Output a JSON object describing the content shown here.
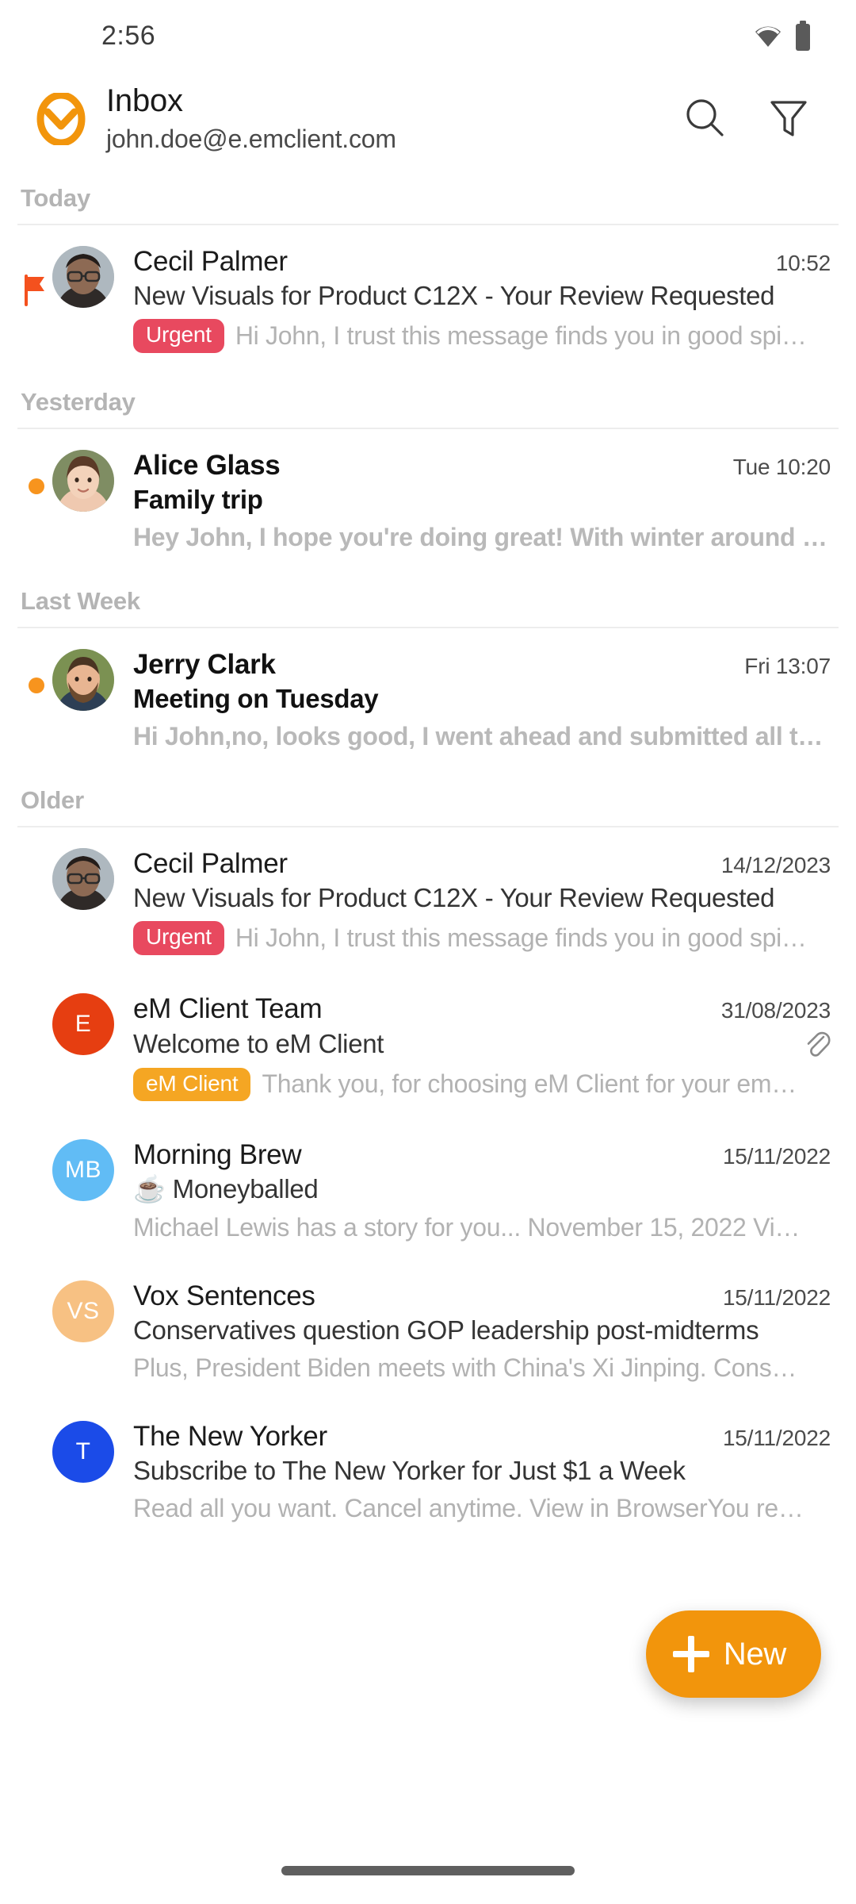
{
  "status_bar": {
    "time": "2:56",
    "wifi_icon": "wifi-icon",
    "battery_icon": "battery-icon"
  },
  "header": {
    "logo_icon": "em-client-logo-icon",
    "title": "Inbox",
    "account": "john.doe@e.emclient.com",
    "search_icon": "search-icon",
    "filter_icon": "filter-funnel-icon",
    "accent_color": "#F2950C"
  },
  "sections": [
    {
      "label": "Today",
      "messages": [
        {
          "sender": "Cecil Palmer",
          "time": "10:52",
          "subject": "New Visuals for Product C12X - Your Review Requested",
          "preview": "Hi John, I trust this message finds you in good spi…",
          "tag": "Urgent",
          "tag_color": "#E8495F",
          "unread": false,
          "flagged": true,
          "attachment": false,
          "avatar_type": "photo-man-glasses",
          "avatar_initials": "",
          "avatar_color": "#9aa6ae"
        }
      ]
    },
    {
      "label": "Yesterday",
      "messages": [
        {
          "sender": "Alice Glass",
          "time": "Tue 10:20",
          "subject": "Family trip",
          "preview": "Hey John, I hope you're doing great! With winter around t…",
          "tag": "",
          "tag_color": "",
          "unread": true,
          "flagged": false,
          "attachment": false,
          "avatar_type": "photo-woman",
          "avatar_initials": "",
          "avatar_color": "#c8a98e"
        }
      ]
    },
    {
      "label": "Last Week",
      "messages": [
        {
          "sender": "Jerry Clark",
          "time": "Fri 13:07",
          "subject": "Meeting on Tuesday",
          "preview": "Hi John,no, looks good, I went ahead and submitted all th…",
          "tag": "",
          "tag_color": "",
          "unread": true,
          "flagged": false,
          "attachment": false,
          "avatar_type": "photo-man-beard",
          "avatar_initials": "",
          "avatar_color": "#7e8f5e"
        }
      ]
    },
    {
      "label": "Older",
      "messages": [
        {
          "sender": "Cecil Palmer",
          "time": "14/12/2023",
          "subject": "New Visuals for Product C12X - Your Review Requested",
          "preview": "Hi John, I trust this message finds you in good spi…",
          "tag": "Urgent",
          "tag_color": "#E8495F",
          "unread": false,
          "flagged": false,
          "attachment": false,
          "avatar_type": "photo-man-glasses",
          "avatar_initials": "",
          "avatar_color": "#9aa6ae"
        },
        {
          "sender": "eM Client Team",
          "time": "31/08/2023",
          "subject": "Welcome to eM Client",
          "preview": "Thank you, for choosing eM Client for your em…",
          "tag": "eM Client",
          "tag_color": "#F5A623",
          "unread": false,
          "flagged": false,
          "attachment": true,
          "avatar_type": "initials",
          "avatar_initials": "E",
          "avatar_color": "#E63E11"
        },
        {
          "sender": "Morning Brew",
          "time": "15/11/2022",
          "subject": "☕ Moneyballed",
          "preview": "Michael Lewis has a story for you... November 15, 2022 Vi…",
          "tag": "",
          "tag_color": "",
          "unread": false,
          "flagged": false,
          "attachment": false,
          "avatar_type": "initials",
          "avatar_initials": "MB",
          "avatar_color": "#61BCF5"
        },
        {
          "sender": "Vox Sentences",
          "time": "15/11/2022",
          "subject": "Conservatives question GOP leadership post-midterms",
          "preview": "Plus, President Biden meets with China's Xi Jinping. Cons…",
          "tag": "",
          "tag_color": "",
          "unread": false,
          "flagged": false,
          "attachment": false,
          "avatar_type": "initials",
          "avatar_initials": "VS",
          "avatar_color": "#F7C183"
        },
        {
          "sender": "The New Yorker",
          "time": "15/11/2022",
          "subject": "Subscribe to The New Yorker for Just $1 a Week",
          "preview": "Read all you want. Cancel anytime. View in BrowserYou re…",
          "tag": "",
          "tag_color": "",
          "unread": false,
          "flagged": false,
          "attachment": false,
          "avatar_type": "initials",
          "avatar_initials": "T",
          "avatar_color": "#1B4BE8"
        }
      ]
    }
  ],
  "compose_button": {
    "label": "New",
    "plus_icon": "plus-icon",
    "color": "#F2950C"
  },
  "nav_handle_icon": "home-gesture-handle"
}
